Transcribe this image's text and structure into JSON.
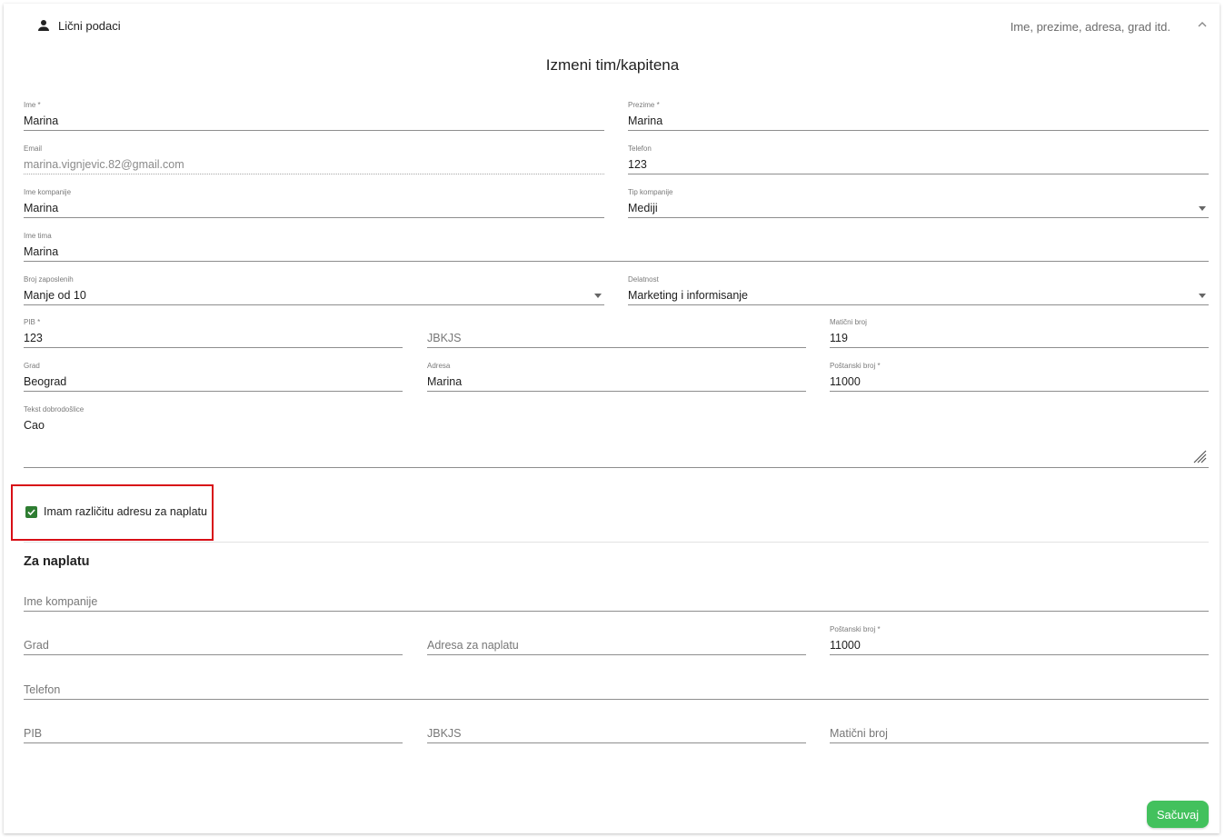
{
  "header": {
    "title": "Lični podaci",
    "subtitle": "Ime, prezime, adresa, grad itd."
  },
  "form": {
    "title": "Izmeni tim/kapitena",
    "ime": {
      "label": "Ime *",
      "value": "Marina"
    },
    "prezime": {
      "label": "Prezime *",
      "value": "Marina"
    },
    "email": {
      "label": "Email",
      "value": "marina.vignjevic.82@gmail.com"
    },
    "telefon": {
      "label": "Telefon",
      "value": "123"
    },
    "ime_kompanije": {
      "label": "Ime kompanije",
      "value": "Marina"
    },
    "tip_kompanije": {
      "label": "Tip kompanije",
      "value": "Mediji"
    },
    "ime_tima": {
      "label": "Ime tima",
      "value": "Marina"
    },
    "broj_zaposlenih": {
      "label": "Broj zaposlenih",
      "value": "Manje od 10"
    },
    "delatnost": {
      "label": "Delatnost",
      "value": "Marketing i informisanje"
    },
    "pib": {
      "label": "PIB *",
      "value": "123"
    },
    "jbkjs": {
      "placeholder": "JBKJS"
    },
    "maticni_broj": {
      "label": "Matični broj",
      "value": "119"
    },
    "grad": {
      "label": "Grad",
      "value": "Beograd"
    },
    "adresa": {
      "label": "Adresa",
      "value": "Marina"
    },
    "postanski_broj": {
      "label": "Poštanski broj *",
      "value": "11000"
    },
    "tekst_dobrodoslice": {
      "label": "Tekst dobrodošlice",
      "value": "Cao"
    }
  },
  "billing_checkbox": {
    "label": "Imam različitu adresu za naplatu",
    "checked": true
  },
  "billing": {
    "heading": "Za naplatu",
    "ime_kompanije": {
      "placeholder": "Ime kompanije"
    },
    "grad": {
      "placeholder": "Grad"
    },
    "adresa": {
      "placeholder": "Adresa za naplatu"
    },
    "postanski_broj": {
      "label": "Poštanski broj *",
      "value": "11000"
    },
    "telefon": {
      "placeholder": "Telefon"
    },
    "pib": {
      "placeholder": "PIB"
    },
    "jbkjs": {
      "placeholder": "JBKJS"
    },
    "maticni_broj": {
      "placeholder": "Matični broj"
    }
  },
  "actions": {
    "save_label": "Sačuvaj"
  },
  "colors": {
    "accent_green": "#43c15d",
    "checkbox_green": "#2e7d32",
    "highlight_red": "#d80f16"
  },
  "icons": [
    "person-icon",
    "chevron-up-icon",
    "dropdown-caret-icon",
    "resize-handle-icon",
    "check-icon"
  ]
}
